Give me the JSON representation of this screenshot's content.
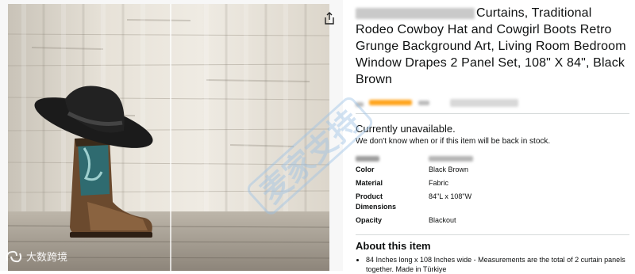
{
  "product": {
    "title": "Curtains, Traditional Rodeo Cowboy Hat and Cowgirl Boots Retro Grunge Background Art, Living Room Bedroom Window Drapes 2 Panel Set, 108\" X 84\", Black Brown",
    "availability": "Currently unavailable.",
    "availability_note": "We don't know when or if this item will be back in stock."
  },
  "specs": [
    {
      "label": "Color",
      "value": "Black Brown"
    },
    {
      "label": "Material",
      "value": "Fabric"
    },
    {
      "label": "Product Dimensions",
      "value": "84\"L x 108\"W"
    },
    {
      "label": "Opacity",
      "value": "Blackout"
    }
  ],
  "about": {
    "heading": "About this item",
    "bullets": [
      "84 Inches long x 108 Inches wide - Measurements are the total of 2 curtain panels together. Made in Türkiye"
    ]
  },
  "icons": {
    "share": "share-icon",
    "watermark": "brand-logo-icon"
  },
  "watermark": {
    "brand": "大数跨境",
    "diagonal": "麦家支持"
  },
  "colors": {
    "rating_star": "#ffa41c",
    "divider": "#d5d9d9",
    "watermark_blue": "#9ec3e6"
  }
}
